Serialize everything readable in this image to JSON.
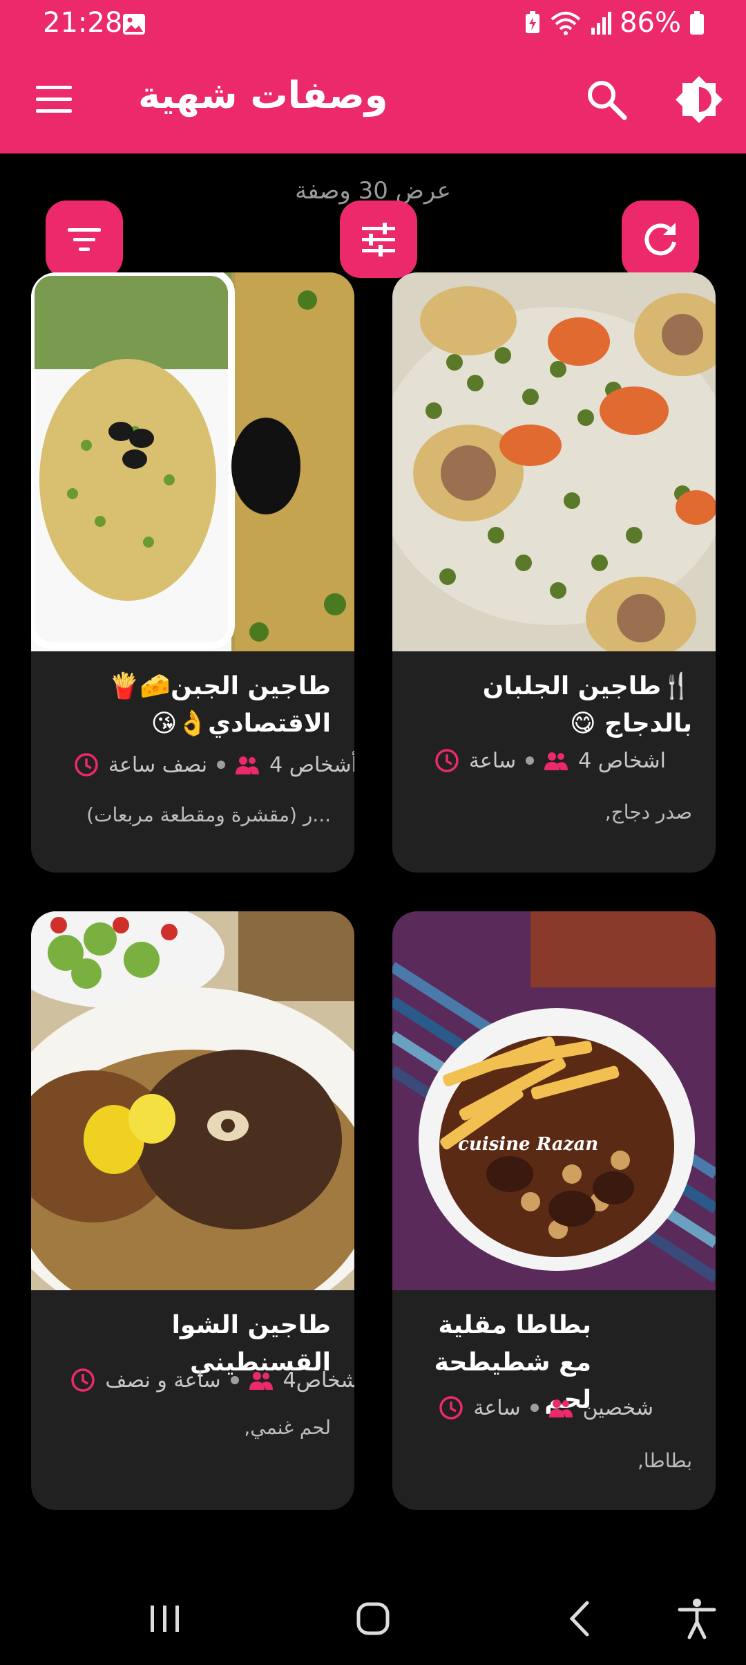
{
  "status": {
    "time": "21:28",
    "battery": "86%"
  },
  "app": {
    "title": "وصفات شهية"
  },
  "count_text": "عرض 30 وصفة",
  "colors": {
    "accent": "#ec2a6b",
    "card_bg": "#212121",
    "background": "#000000"
  },
  "icons": {
    "menu": "menu-icon",
    "search": "search-icon",
    "theme": "brightness-icon",
    "filter": "filter-icon",
    "tune": "tune-icon",
    "refresh": "refresh-icon",
    "time": "clock-icon",
    "people": "people-icon"
  },
  "recipes": [
    {
      "title": "🍴طاجين الجلبان بالدجاج 😋",
      "people": "اشخاص 4",
      "time": "ساعة",
      "ingredients": "صدر دجاج,"
    },
    {
      "title": "طاجين الجبن🧀🍟 الاقتصادي👌😘",
      "people": "أشخاص 4",
      "time": "نصف ساعة",
      "ingredients": "...ر (مقشرة ومقطعة مربعات)"
    },
    {
      "title": "بطاطا مقلية مع شطيطحة لحم",
      "people": "شخصين",
      "time": "ساعة",
      "ingredients": "بطاطا,"
    },
    {
      "title": "طاجين الشوا القسنطيني",
      "people": "أشخاص4",
      "time": "ساعة و نصف",
      "ingredients": "لحم غنمي,"
    }
  ],
  "image_watermark": "cuisine Razan"
}
